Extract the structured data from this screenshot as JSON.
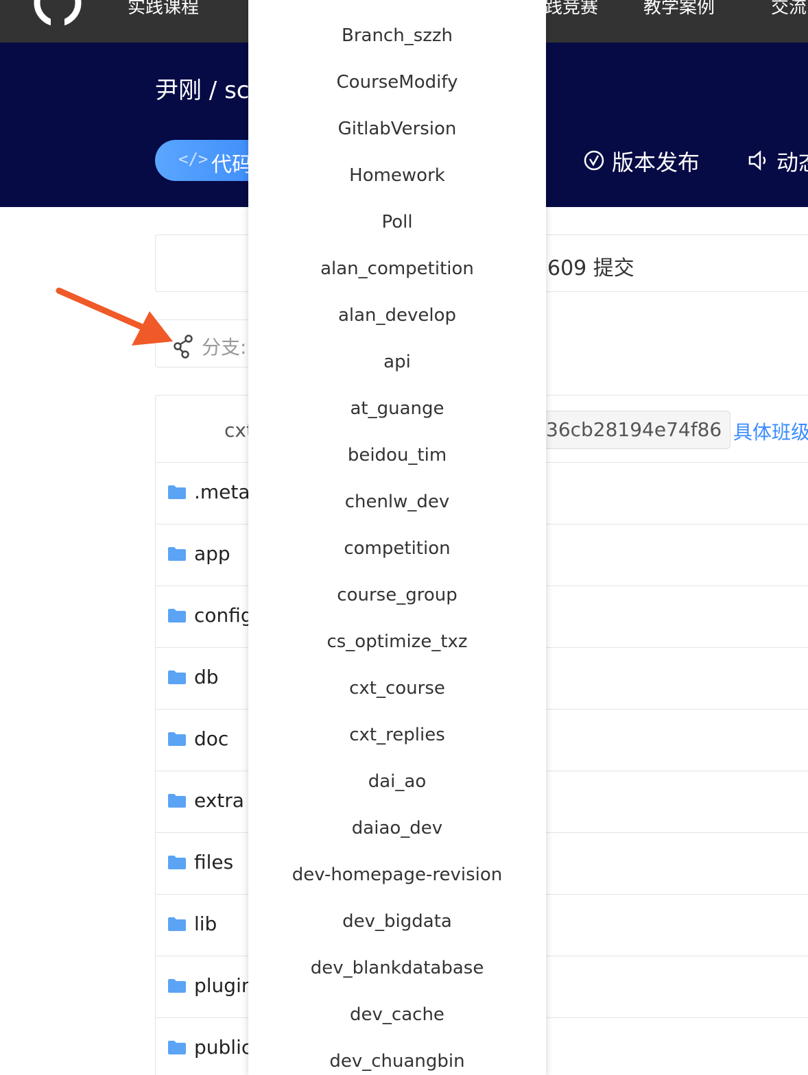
{
  "topnav": {
    "items": [
      "实践课程",
      "践竞赛",
      "教学案例",
      "交流"
    ]
  },
  "repo": {
    "breadcrumb": "尹刚 / sc",
    "tabs": {
      "code": "代码",
      "releases": "版本发布",
      "activity": "动态"
    }
  },
  "stats": {
    "commits": "609 提交"
  },
  "branch": {
    "label": "分支:"
  },
  "latest_commit": {
    "author": "cxt",
    "hash": "36cb28194e74f86",
    "message": "具体班级"
  },
  "files": [
    ".metac",
    "app",
    "config",
    "db",
    "doc",
    "extra",
    "files",
    "lib",
    "plugin",
    "public"
  ],
  "branches": [
    "Branch_szzh",
    "CourseModify",
    "GitlabVersion",
    "Homework",
    "Poll",
    "alan_competition",
    "alan_develop",
    "api",
    "at_guange",
    "beidou_tim",
    "chenlw_dev",
    "competition",
    "course_group",
    "cs_optimize_txz",
    "cxt_course",
    "cxt_replies",
    "dai_ao",
    "daiao_dev",
    "dev-homepage-revision",
    "dev_bigdata",
    "dev_blankdatabase",
    "dev_cache",
    "dev_chuangbin"
  ],
  "colors": {
    "nav_bg": "#333333",
    "banner_bg": "#060a45",
    "accent": "#3b8cff",
    "folder": "#5ba3f5",
    "arrow": "#f05a28"
  }
}
